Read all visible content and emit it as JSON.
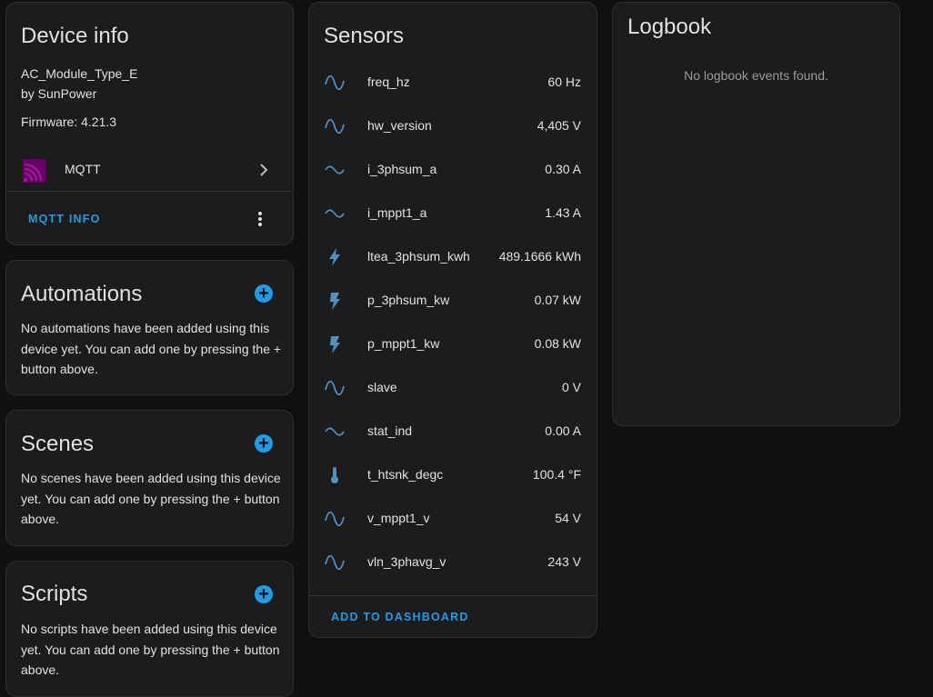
{
  "device_info": {
    "title": "Device info",
    "model": "AC_Module_Type_E",
    "manufacturer": "by SunPower",
    "firmware": "Firmware: 4.21.3",
    "integration_label": "MQTT",
    "integration_icon": "mqtt-icon",
    "action_label": "MQTT INFO",
    "menu_icon": "more-vertical-icon"
  },
  "automations": {
    "title": "Automations",
    "text": "No automations have been added using this device yet. You can add one by pressing the + button above.",
    "add_symbol": "+"
  },
  "scenes": {
    "title": "Scenes",
    "text": "No scenes have been added using this device yet. You can add one by pressing the + button above.",
    "add_symbol": "+"
  },
  "scripts": {
    "title": "Scripts",
    "text": "No scripts have been added using this device yet. You can add one by pressing the + button above.",
    "add_symbol": "+"
  },
  "sensors": {
    "title": "Sensors",
    "items": [
      {
        "name": "freq_hz",
        "value": "60 Hz",
        "icon": "sine-wave-icon"
      },
      {
        "name": "hw_version",
        "value": "4,405 V",
        "icon": "sine-wave-icon"
      },
      {
        "name": "i_3phsum_a",
        "value": "0.30 A",
        "icon": "current-ac-icon"
      },
      {
        "name": "i_mppt1_a",
        "value": "1.43 A",
        "icon": "current-ac-icon"
      },
      {
        "name": "ltea_3phsum_kwh",
        "value": "489.1666 kWh",
        "icon": "lightning-bolt-icon"
      },
      {
        "name": "p_3phsum_kw",
        "value": "0.07 kW",
        "icon": "flash-icon"
      },
      {
        "name": "p_mppt1_kw",
        "value": "0.08 kW",
        "icon": "flash-icon"
      },
      {
        "name": "slave",
        "value": "0 V",
        "icon": "sine-wave-icon"
      },
      {
        "name": "stat_ind",
        "value": "0.00 A",
        "icon": "current-ac-icon"
      },
      {
        "name": "t_htsnk_degc",
        "value": "100.4 °F",
        "icon": "thermometer-icon"
      },
      {
        "name": "v_mppt1_v",
        "value": "54 V",
        "icon": "sine-wave-icon"
      },
      {
        "name": "vln_3phavg_v",
        "value": "243 V",
        "icon": "sine-wave-icon"
      }
    ],
    "action_label": "ADD TO DASHBOARD"
  },
  "logbook": {
    "title": "Logbook",
    "empty_text": "No logbook events found."
  },
  "colors": {
    "background": "#111111",
    "card": "#1c1c1c",
    "accent": "#1e9ce8",
    "icon": "#4f8fc2",
    "mqtt_brand": "#660066"
  }
}
